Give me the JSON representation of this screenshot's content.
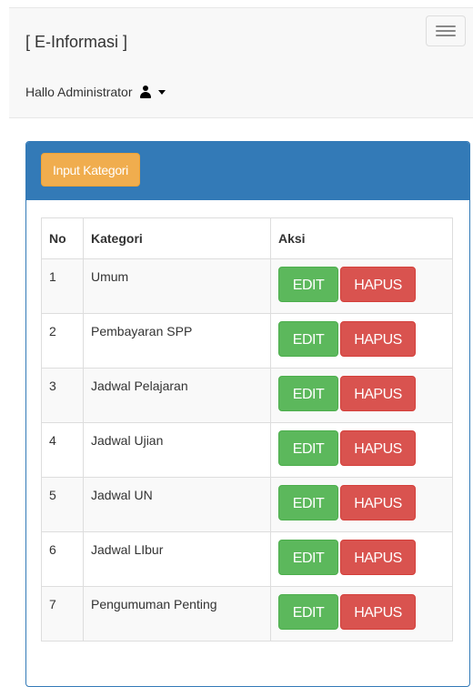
{
  "navbar": {
    "brand": "[ E-Informasi ]",
    "user_greeting": "Hallo Administrator",
    "user_icon": "user-icon",
    "menu_icon": "hamburger-menu-icon"
  },
  "panel": {
    "input_button_label": "Input Kategori"
  },
  "table": {
    "headers": [
      "No",
      "Kategori",
      "Aksi"
    ],
    "rows": [
      {
        "no": "1",
        "kategori": "Umum"
      },
      {
        "no": "2",
        "kategori": "Pembayaran SPP"
      },
      {
        "no": "3",
        "kategori": "Jadwal Pelajaran"
      },
      {
        "no": "4",
        "kategori": "Jadwal Ujian"
      },
      {
        "no": "5",
        "kategori": "Jadwal UN"
      },
      {
        "no": "6",
        "kategori": "Jadwal LIbur"
      },
      {
        "no": "7",
        "kategori": "Pengumuman Penting"
      }
    ],
    "edit_label": "EDIT",
    "delete_label": "HAPUS"
  },
  "colors": {
    "panel_primary": "#337ab7",
    "warning": "#f0ad4e",
    "success": "#5cb85c",
    "danger": "#d9534f"
  }
}
